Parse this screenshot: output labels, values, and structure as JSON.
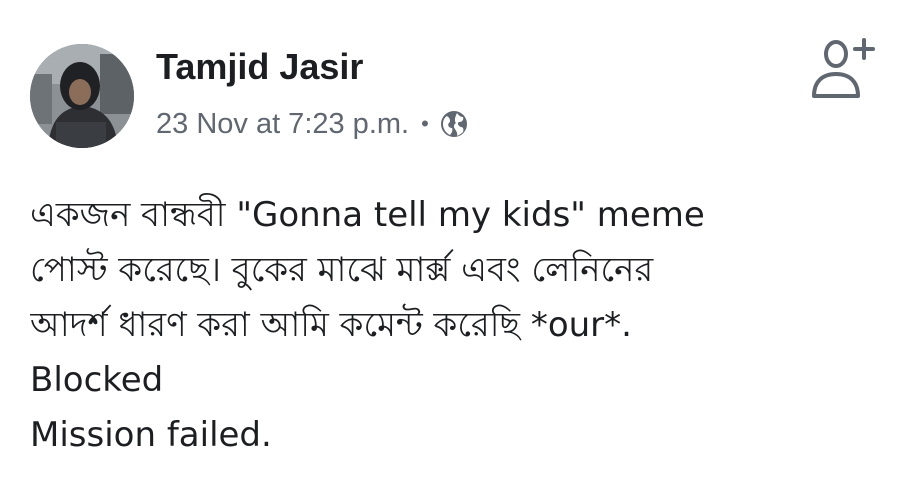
{
  "post": {
    "author_name": "Tamjid Jasir",
    "timestamp": "23 Nov at 7:23 p.m.",
    "separator": "•",
    "privacy_icon": "globe-icon",
    "avatar_icon": "profile-photo",
    "add_friend_icon": "add-friend-icon",
    "body_lines": [
      "একজন বান্ধবী \"Gonna tell my kids\" meme",
      "পোস্ট করেছে। বুকের মাঝে মার্ক্স এবং লেনিনের",
      "আদর্শ ধারণ করা আমি কমেন্ট করেছি *our*.",
      "Blocked",
      "Mission failed."
    ]
  },
  "colors": {
    "text": "#1c1e21",
    "meta": "#606770",
    "icon": "#606770",
    "background": "#ffffff"
  }
}
